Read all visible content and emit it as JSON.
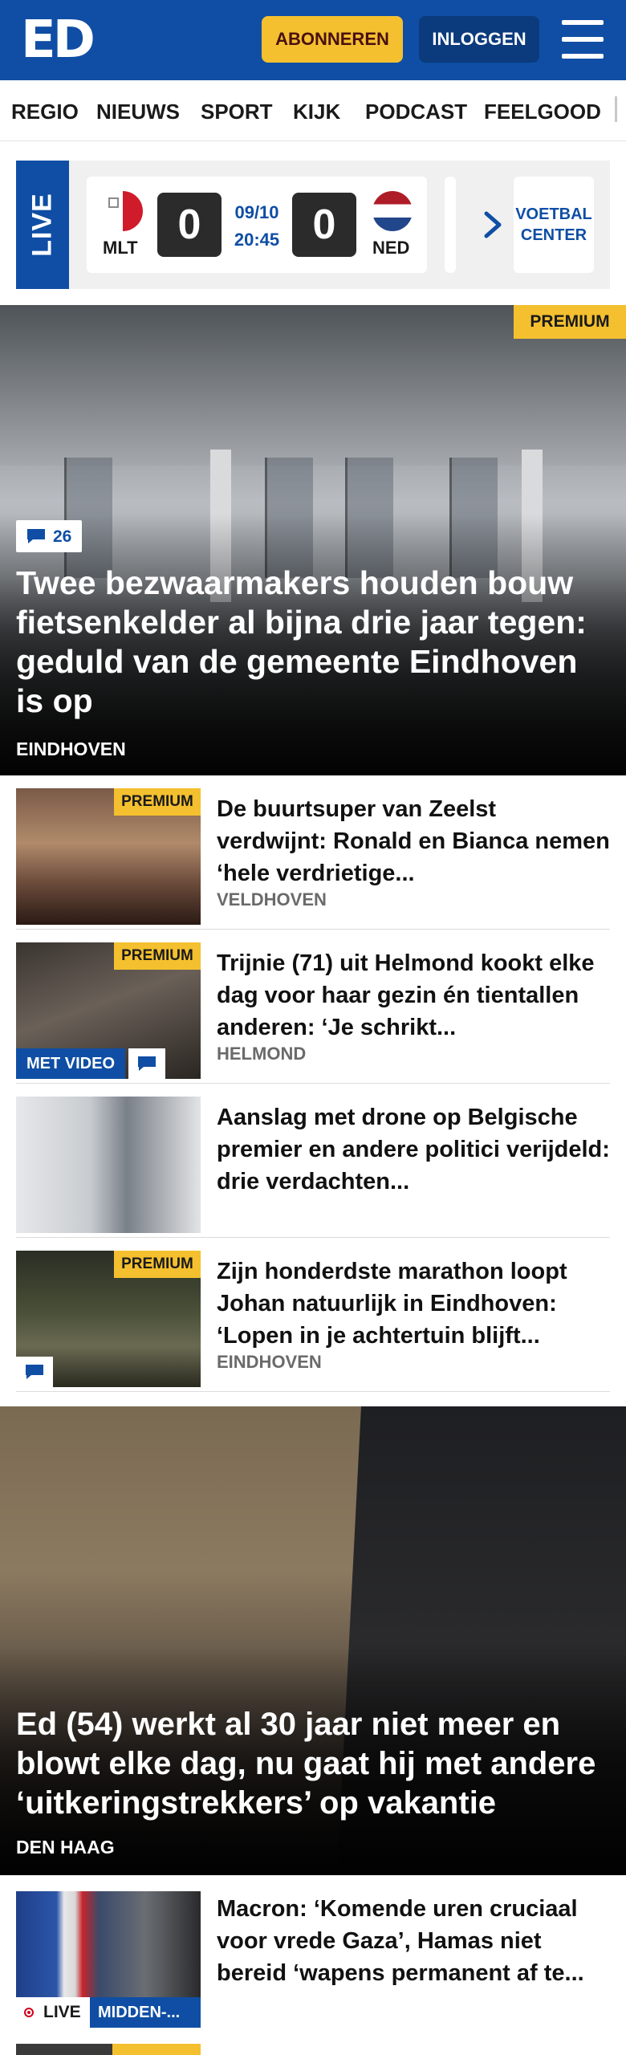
{
  "header": {
    "logo": "ED",
    "subscribe_label": "ABONNEREN",
    "login_label": "INLOGGEN",
    "menu_icon": "hamburger-menu-icon"
  },
  "nav": {
    "items": [
      "REGIO",
      "NIEUWS",
      "SPORT",
      "KIJK",
      "PODCAST",
      "FEELGOOD"
    ]
  },
  "live": {
    "tab_label": "LIVE",
    "match": {
      "home_code": "MLT",
      "home_score": "0",
      "date": "09/10",
      "time": "20:45",
      "away_code": "NED",
      "away_score": "0"
    },
    "voetbal_center_label": "VOETBAL CENTER"
  },
  "hero": {
    "badge": "PREMIUM",
    "comments": "26",
    "title": "Twee bezwaarmakers houden bouw fietsenkelder al bijna drie jaar tegen: geduld van de gemeente Eindhoven is op",
    "region": "EINDHOVEN"
  },
  "articles": [
    {
      "premium": "PREMIUM",
      "title": "De buurtsuper van Zeelst verdwijnt: Ronald en Bianca nemen ‘hele verdrietige...",
      "region": "VELDHOVEN"
    },
    {
      "premium": "PREMIUM",
      "video": "MET VIDEO",
      "title": "Trijnie (71) uit Helmond kookt elke dag voor haar gezin én tientallen anderen: ‘Je schrikt...",
      "region": "HELMOND"
    },
    {
      "title": "Aanslag met drone op Belgische premier en andere politici verijdeld: drie verdachten..."
    },
    {
      "premium": "PREMIUM",
      "title": "Zijn honderdste marathon loopt Johan natuurlijk in Eindhoven: ‘Lopen in je achtertuin blijft...",
      "region": "EINDHOVEN"
    }
  ],
  "hero2": {
    "title": "Ed (54) werkt al 30 jaar niet meer en blowt elke dag, nu gaat hij met andere ‘uitkeringstrekkers’ op vakantie",
    "region": "DEN HAAG"
  },
  "article_live": {
    "live_label": "LIVE",
    "category": "MIDDEN-...",
    "title": "Macron: ‘Komende uren cruciaal voor vrede Gaza’, Hamas niet bereid ‘wapens permanent af te..."
  },
  "colors": {
    "brand_blue": "#0f4ea4",
    "premium_yellow": "#f4c02f",
    "dark_blue": "#0b3b7c"
  }
}
